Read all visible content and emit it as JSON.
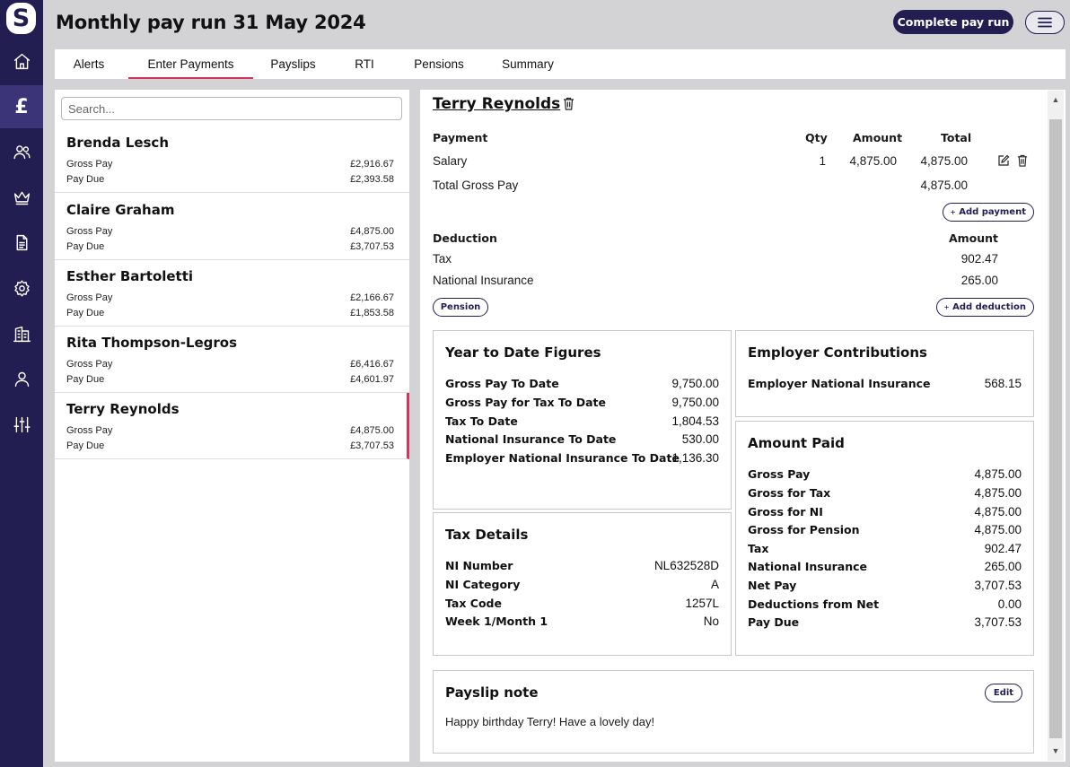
{
  "app": {
    "logo_letter": "S"
  },
  "header": {
    "title": "Monthly pay run 31 May 2024",
    "complete_label": "Complete pay run"
  },
  "sidebar": {
    "items": [
      {
        "icon": "home-icon"
      },
      {
        "icon": "pound-icon",
        "glyph": "£",
        "active": true
      },
      {
        "icon": "people-icon"
      },
      {
        "icon": "crown-icon"
      },
      {
        "icon": "document-icon"
      },
      {
        "icon": "gear-icon"
      },
      {
        "icon": "building-icon"
      },
      {
        "icon": "person-icon"
      },
      {
        "icon": "sliders-icon"
      }
    ]
  },
  "tabs": [
    {
      "label": "Alerts"
    },
    {
      "label": "Enter Payments",
      "active": true
    },
    {
      "label": "Payslips"
    },
    {
      "label": "RTI"
    },
    {
      "label": "Pensions"
    },
    {
      "label": "Summary"
    }
  ],
  "search": {
    "placeholder": "Search..."
  },
  "employees": [
    {
      "name": "Brenda Lesch",
      "gross_label": "Gross Pay",
      "gross": "£2,916.67",
      "due_label": "Pay Due",
      "due": "£2,393.58"
    },
    {
      "name": "Claire Graham",
      "gross_label": "Gross Pay",
      "gross": "£4,875.00",
      "due_label": "Pay Due",
      "due": "£3,707.53"
    },
    {
      "name": "Esther Bartoletti",
      "gross_label": "Gross Pay",
      "gross": "£2,166.67",
      "due_label": "Pay Due",
      "due": "£1,853.58"
    },
    {
      "name": "Rita Thompson-Legros",
      "gross_label": "Gross Pay",
      "gross": "£6,416.67",
      "due_label": "Pay Due",
      "due": "£4,601.97"
    },
    {
      "name": "Terry Reynolds",
      "gross_label": "Gross Pay",
      "gross": "£4,875.00",
      "due_label": "Pay Due",
      "due": "£3,707.53",
      "selected": true
    }
  ],
  "detail": {
    "name": "Terry Reynolds",
    "payments": {
      "headers": {
        "payment": "Payment",
        "qty": "Qty",
        "amount": "Amount",
        "total": "Total"
      },
      "rows": [
        {
          "name": "Salary",
          "qty": "1",
          "amount": "4,875.00",
          "total": "4,875.00"
        }
      ],
      "total_label": "Total Gross Pay",
      "total_value": "4,875.00",
      "add_label": "Add payment"
    },
    "deductions": {
      "headers": {
        "deduction": "Deduction",
        "amount": "Amount"
      },
      "rows": [
        {
          "name": "Tax",
          "amount": "902.47"
        },
        {
          "name": "National Insurance",
          "amount": "265.00"
        }
      ],
      "pension_label": "Pension",
      "add_label": "Add deduction"
    },
    "ytd": {
      "title": "Year to Date Figures",
      "rows": [
        {
          "label": "Gross Pay To Date",
          "value": "9,750.00"
        },
        {
          "label": "Gross Pay for Tax To Date",
          "value": "9,750.00"
        },
        {
          "label": "Tax To Date",
          "value": "1,804.53"
        },
        {
          "label": "National Insurance To Date",
          "value": "530.00"
        },
        {
          "label": "Employer National Insurance To Date",
          "value": "1,136.30"
        }
      ]
    },
    "employer": {
      "title": "Employer Contributions",
      "rows": [
        {
          "label": "Employer National Insurance",
          "value": "568.15"
        }
      ]
    },
    "tax_details": {
      "title": "Tax Details",
      "rows": [
        {
          "label": "NI Number",
          "value": "NL632528D"
        },
        {
          "label": "NI Category",
          "value": "A"
        },
        {
          "label": "Tax Code",
          "value": "1257L"
        },
        {
          "label": "Week 1/Month 1",
          "value": "No"
        }
      ]
    },
    "amount_paid": {
      "title": "Amount Paid",
      "rows": [
        {
          "label": "Gross Pay",
          "value": "4,875.00"
        },
        {
          "label": "Gross for Tax",
          "value": "4,875.00"
        },
        {
          "label": "Gross for NI",
          "value": "4,875.00"
        },
        {
          "label": "Gross for Pension",
          "value": "4,875.00"
        },
        {
          "label": "Tax",
          "value": "902.47"
        },
        {
          "label": "National Insurance",
          "value": "265.00"
        },
        {
          "label": "Net Pay",
          "value": "3,707.53"
        },
        {
          "label": "Deductions from Net",
          "value": "0.00"
        },
        {
          "label": "Pay Due",
          "value": "3,707.53"
        }
      ]
    },
    "payslip_note": {
      "title": "Payslip note",
      "edit_label": "Edit",
      "text": "Happy birthday Terry! Have a lovely day!"
    }
  }
}
